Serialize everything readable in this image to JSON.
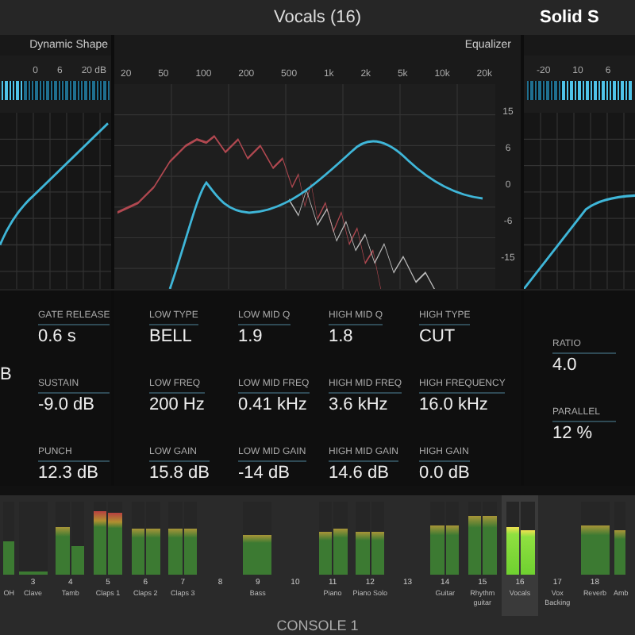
{
  "header": {
    "title": "Vocals (16)",
    "right_title": "Solid S"
  },
  "left_panel": {
    "title": "Dynamic Shape",
    "scale": [
      "0",
      "6",
      "20 dB"
    ],
    "cut_value": "B",
    "params": [
      {
        "label": "GATE RELEASE",
        "value": "0.6 s"
      },
      {
        "label": "SUSTAIN",
        "value": "-9.0 dB"
      },
      {
        "label": "PUNCH",
        "value": "12.3 dB"
      }
    ]
  },
  "equalizer": {
    "title": "Equalizer",
    "freq_ticks": [
      "20",
      "50",
      "100",
      "200",
      "500",
      "1k",
      "2k",
      "5k",
      "10k",
      "20k"
    ],
    "db_ticks": [
      "15",
      "6",
      "0",
      "-6",
      "-15"
    ],
    "params": [
      {
        "label": "LOW TYPE",
        "value": "BELL"
      },
      {
        "label": "LOW MID Q",
        "value": "1.9"
      },
      {
        "label": "HIGH MID Q",
        "value": "1.8"
      },
      {
        "label": "HIGH TYPE",
        "value": "CUT"
      },
      {
        "label": "LOW FREQ",
        "value": "200 Hz"
      },
      {
        "label": "LOW MID FREQ",
        "value": "0.41 kHz"
      },
      {
        "label": "HIGH MID FREQ",
        "value": "3.6 kHz"
      },
      {
        "label": "HIGH FREQUENCY",
        "value": "16.0 kHz"
      },
      {
        "label": "LOW GAIN",
        "value": "15.8 dB"
      },
      {
        "label": "LOW MID GAIN",
        "value": "-14 dB"
      },
      {
        "label": "HIGH MID GAIN",
        "value": "14.6 dB"
      },
      {
        "label": "HIGH GAIN",
        "value": "0.0 dB"
      }
    ]
  },
  "right_panel": {
    "scale": [
      "-20",
      "10",
      "6"
    ],
    "params": [
      {
        "label": "RATIO",
        "value": "4.0"
      },
      {
        "label": "PARALLEL",
        "value": "12 %"
      }
    ]
  },
  "mixer": {
    "title": "CONSOLE 1",
    "channels": [
      {
        "name": "OH",
        "selected": false,
        "meters": [
          {
            "level": 0.45
          }
        ]
      },
      {
        "number": "3",
        "name": "Clave",
        "selected": false,
        "meters": [
          {
            "level": 0.05
          }
        ]
      },
      {
        "number": "4",
        "name": "Tamb",
        "selected": false,
        "meters": [
          {
            "level": 0.65
          },
          {
            "level": 0.4
          }
        ]
      },
      {
        "number": "5",
        "name": "Claps 1",
        "selected": false,
        "meters": [
          {
            "level": 0.88
          },
          {
            "level": 0.85
          }
        ]
      },
      {
        "number": "6",
        "name": "Claps 2",
        "selected": false,
        "meters": [
          {
            "level": 0.62
          },
          {
            "level": 0.62
          }
        ]
      },
      {
        "number": "7",
        "name": "Claps 3",
        "selected": false,
        "meters": [
          {
            "level": 0.62
          },
          {
            "level": 0.62
          }
        ]
      },
      {
        "number": "8",
        "selected": false
      },
      {
        "number": "9",
        "name": "Bass",
        "selected": false,
        "meters": [
          {
            "level": 0.55
          }
        ]
      },
      {
        "number": "10",
        "selected": false
      },
      {
        "number": "11",
        "name": "Piano",
        "selected": false,
        "meters": [
          {
            "level": 0.58
          },
          {
            "level": 0.62
          }
        ]
      },
      {
        "number": "12",
        "name": "Piano Solo",
        "selected": false,
        "meters": [
          {
            "level": 0.58
          },
          {
            "level": 0.58
          }
        ]
      },
      {
        "number": "13",
        "selected": false
      },
      {
        "number": "14",
        "name": "Guitar",
        "selected": false,
        "meters": [
          {
            "level": 0.68
          },
          {
            "level": 0.68
          }
        ]
      },
      {
        "number": "15",
        "name": "Rhythm guitar",
        "selected": false,
        "meters": [
          {
            "level": 0.8
          },
          {
            "level": 0.8
          }
        ]
      },
      {
        "number": "16",
        "name": "Vocals",
        "selected": true,
        "meters": [
          {
            "level": 0.65
          },
          {
            "level": 0.6
          }
        ]
      },
      {
        "number": "17",
        "name": "Vox Backing",
        "selected": false
      },
      {
        "number": "18",
        "name": "Reverb",
        "selected": false,
        "meters": [
          {
            "level": 0.68
          }
        ]
      },
      {
        "name": "Amb",
        "selected": false,
        "meters": [
          {
            "level": 0.6
          }
        ]
      }
    ]
  }
}
